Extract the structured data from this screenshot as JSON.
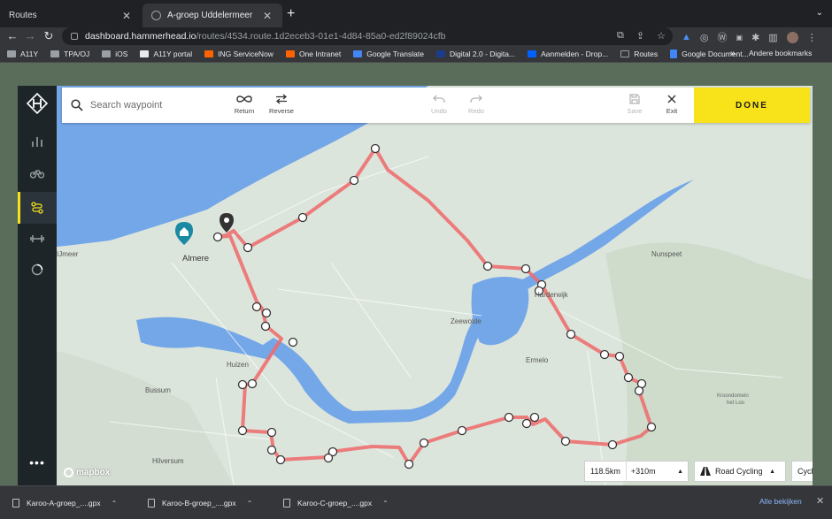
{
  "browser": {
    "tabs": [
      {
        "title": "Routes",
        "active": false
      },
      {
        "title": "A-groep Uddelermeer",
        "active": true
      }
    ],
    "url_host": "dashboard.hammerhead.io",
    "url_path": "/routes/4534.route.1d2eceb3-01e1-4d84-85a0-ed2f89024cfb",
    "bookmarks": [
      "A11Y",
      "TPA/OJ",
      "iOS",
      "A11Y portal",
      "ING ServiceNow",
      "One Intranet",
      "Google Translate",
      "Digital 2.0 - Digita...",
      "Aanmelden - Drop...",
      "Routes",
      "Google Document..."
    ],
    "bookmarks_more": "»",
    "other_bookmarks": "Andere bookmarks"
  },
  "app": {
    "search_placeholder": "Search waypoint",
    "tools": {
      "return": "Return",
      "reverse": "Reverse",
      "undo": "Undo",
      "redo": "Redo",
      "save": "Save",
      "exit": "Exit"
    },
    "done_label": "DONE",
    "zoom_in": "+",
    "zoom_out": "−",
    "distance": "118.5km",
    "elevation": "+310m",
    "surface": "Road Cycling",
    "activity": "Cycling",
    "mapbox": "mapbox",
    "more": "•••"
  },
  "map_labels": {
    "almere": "Almere",
    "ijmeer": "IJmeer",
    "zeewolde": "Zeewolde",
    "harderwijk": "Harderwijk",
    "nunspeet": "Nunspeet",
    "ermelo": "Ermelo",
    "huizen": "Huizen",
    "bussum": "Bussum",
    "hilversum": "Hilversum",
    "kroondomein": "Kroondomein",
    "hetloo": "het Loo"
  },
  "colors": {
    "accent": "#f8e21a",
    "route": "#ee6a6a",
    "water": "#74a7e8",
    "land": "#dce5dc",
    "sidebar": "#1d2529"
  },
  "downloads": [
    {
      "name": "Karoo-A-groep_....gpx"
    },
    {
      "name": "Karoo-B-groep_....gpx"
    },
    {
      "name": "Karoo-C-groep_....gpx"
    }
  ],
  "show_all": "Alle bekijken"
}
